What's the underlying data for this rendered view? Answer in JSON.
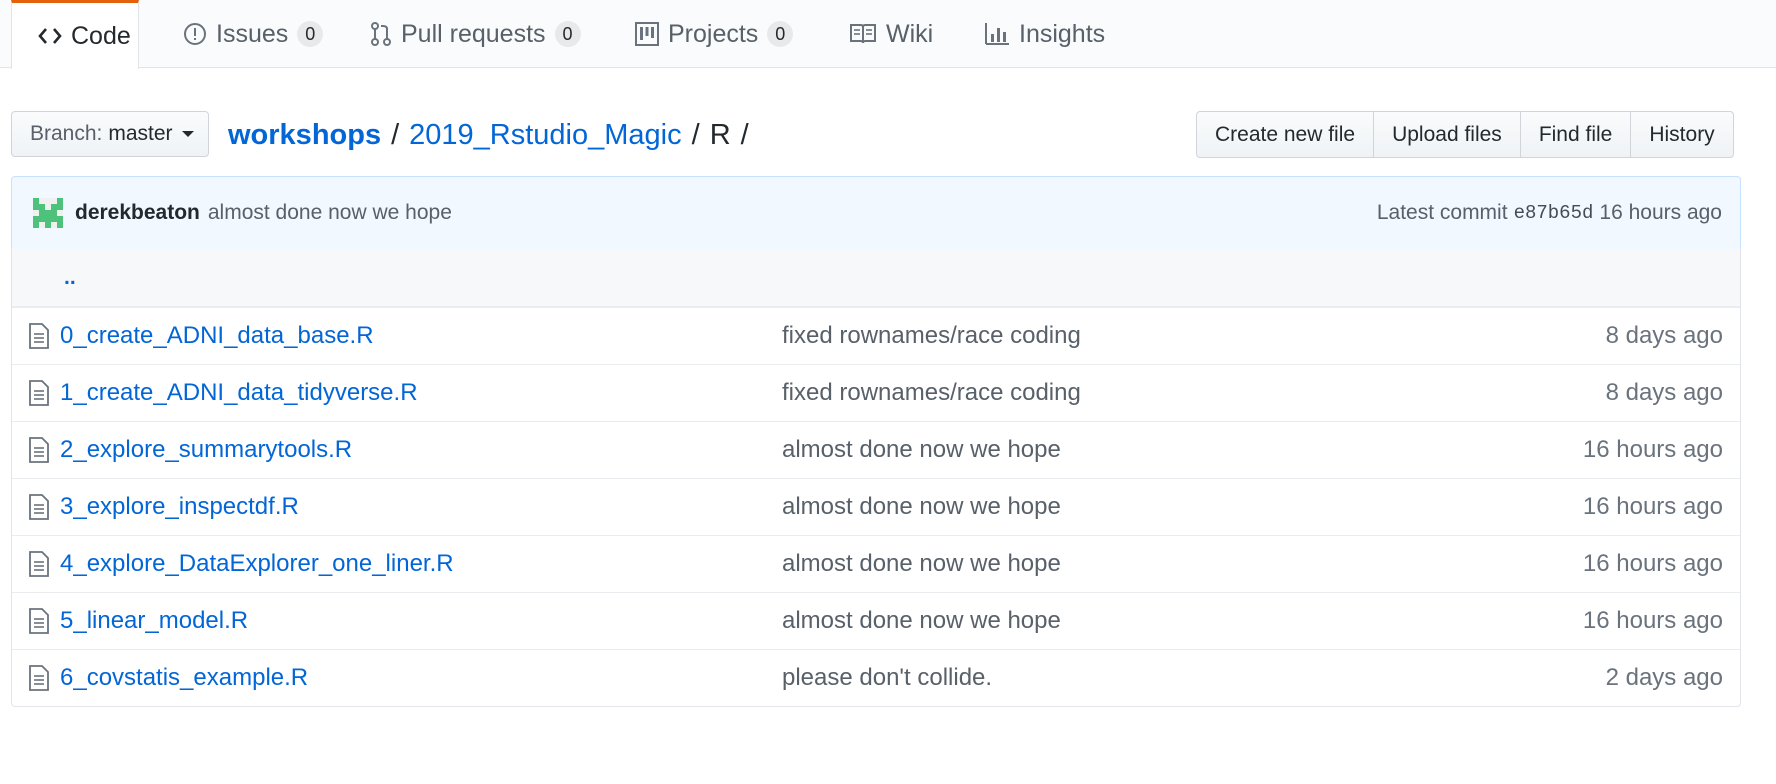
{
  "tabs": [
    {
      "label": "Code",
      "icon": "code-icon",
      "selected": true
    },
    {
      "label": "Issues",
      "icon": "issue-icon",
      "count": "0"
    },
    {
      "label": "Pull requests",
      "icon": "pull-request-icon",
      "count": "0"
    },
    {
      "label": "Projects",
      "icon": "project-icon",
      "count": "0"
    },
    {
      "label": "Wiki",
      "icon": "book-icon"
    },
    {
      "label": "Insights",
      "icon": "graph-icon"
    }
  ],
  "branch": {
    "label": "Branch:",
    "value": "master"
  },
  "breadcrumb": {
    "repo": "workshops",
    "folder": "2019_Rstudio_Magic",
    "current": "R",
    "sep": "/"
  },
  "file_nav": {
    "create": "Create new file",
    "upload": "Upload files",
    "find": "Find file",
    "history": "History"
  },
  "commit": {
    "author": "derekbeaton",
    "message": "almost done now we hope",
    "latest_label": "Latest commit",
    "sha": "e87b65d",
    "age": "16 hours ago"
  },
  "parent_link": "..",
  "files": [
    {
      "name": "0_create_ADNI_data_base.R",
      "message": "fixed rownames/race coding",
      "age": "8 days ago"
    },
    {
      "name": "1_create_ADNI_data_tidyverse.R",
      "message": "fixed rownames/race coding",
      "age": "8 days ago"
    },
    {
      "name": "2_explore_summarytools.R",
      "message": "almost done now we hope",
      "age": "16 hours ago"
    },
    {
      "name": "3_explore_inspectdf.R",
      "message": "almost done now we hope",
      "age": "16 hours ago"
    },
    {
      "name": "4_explore_DataExplorer_one_liner.R",
      "message": "almost done now we hope",
      "age": "16 hours ago"
    },
    {
      "name": "5_linear_model.R",
      "message": "almost done now we hope",
      "age": "16 hours ago"
    },
    {
      "name": "6_covstatis_example.R",
      "message": "please don't collide.",
      "age": "2 days ago"
    }
  ],
  "colors": {
    "link": "#0366d6",
    "tab_accent": "#e36209",
    "commit_bg": "#f1f8ff",
    "avatar": "#4cc27a"
  }
}
